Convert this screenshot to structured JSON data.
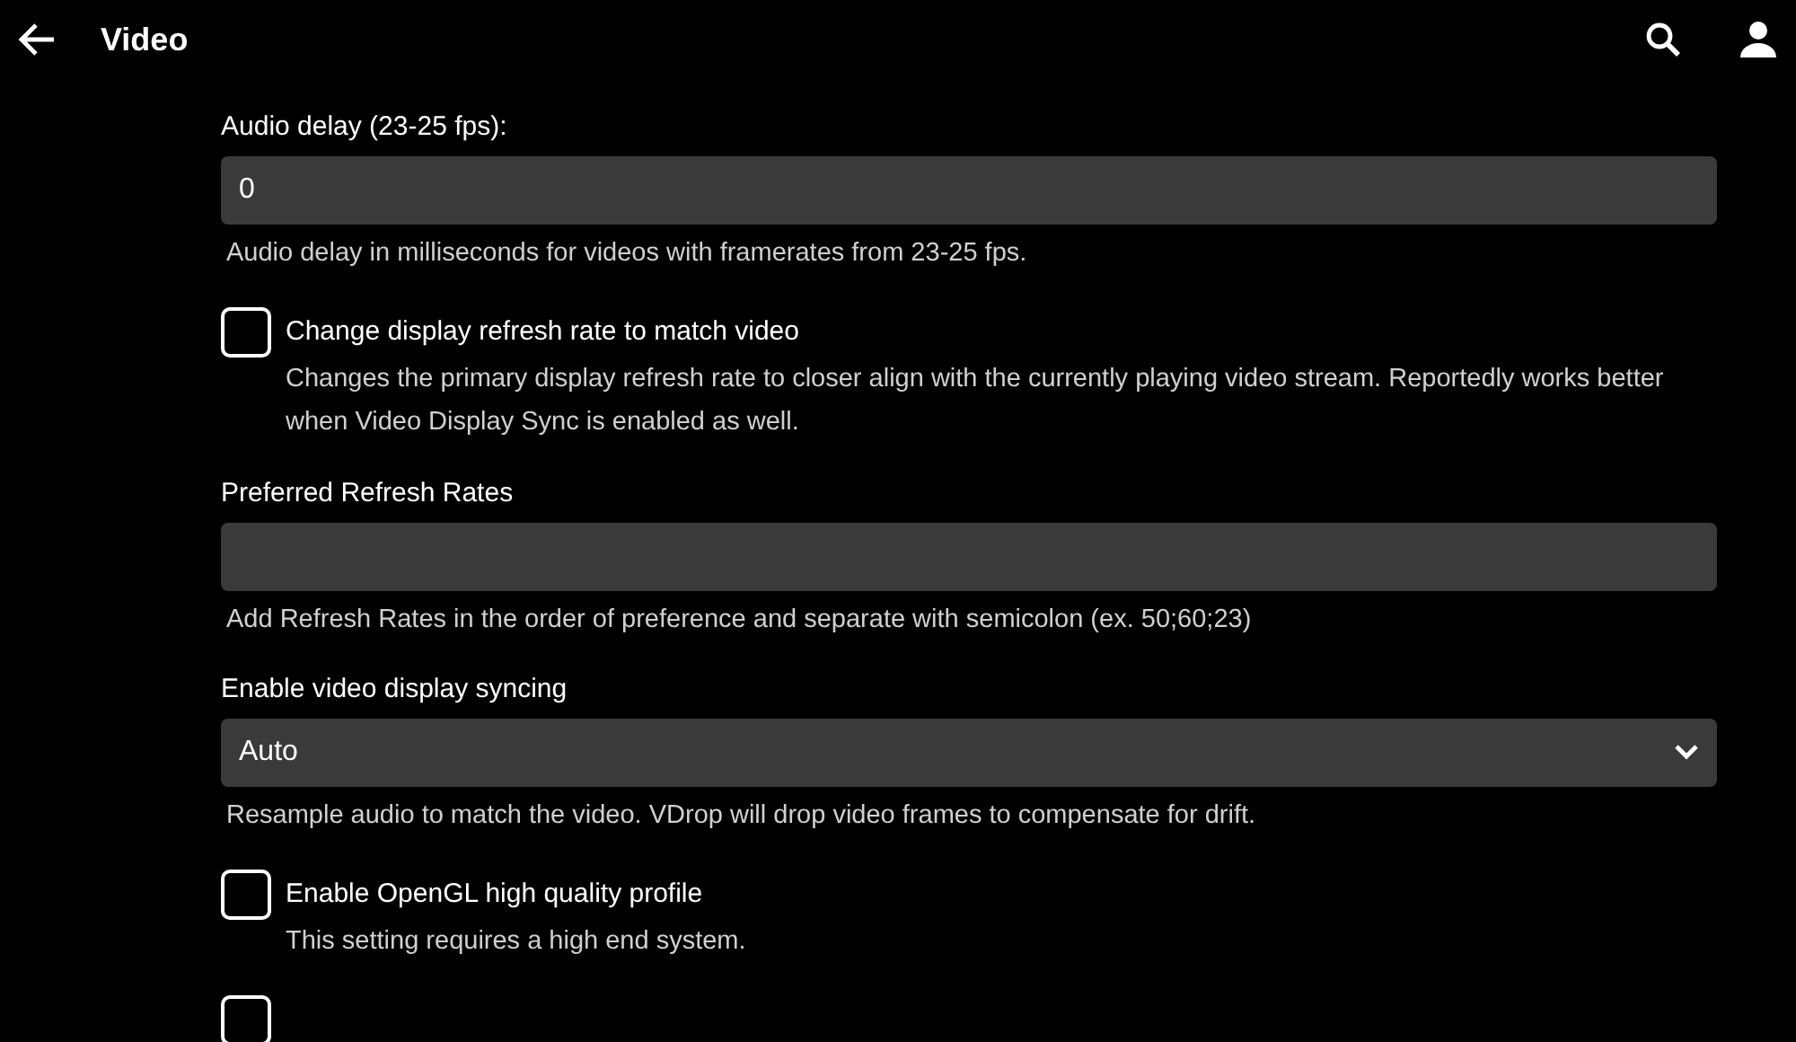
{
  "header": {
    "title": "Video"
  },
  "settings": [
    {
      "kind": "text",
      "label": "Audio delay (23-25 fps):",
      "value": "0",
      "help": "Audio delay in milliseconds for videos with framerates from 23-25 fps."
    },
    {
      "kind": "checkbox",
      "label": "Change display refresh rate to match video",
      "checked": false,
      "help": "Changes the primary display refresh rate to closer align with the currently playing video stream. Reportedly works better when Video Display Sync is enabled as well."
    },
    {
      "kind": "text",
      "label": "Preferred Refresh Rates",
      "help": "Add Refresh Rates in the order of preference and separate with semicolon (ex. 50;60;23)"
    },
    {
      "kind": "select",
      "label": "Enable video display syncing",
      "value": "Auto",
      "help": "Resample audio to match the video. VDrop will drop video frames to compensate for drift."
    },
    {
      "kind": "checkbox",
      "label": "Enable OpenGL high quality profile",
      "checked": false,
      "help": "This setting requires a high end system."
    },
    {
      "kind": "checkbox",
      "checked": false
    }
  ]
}
